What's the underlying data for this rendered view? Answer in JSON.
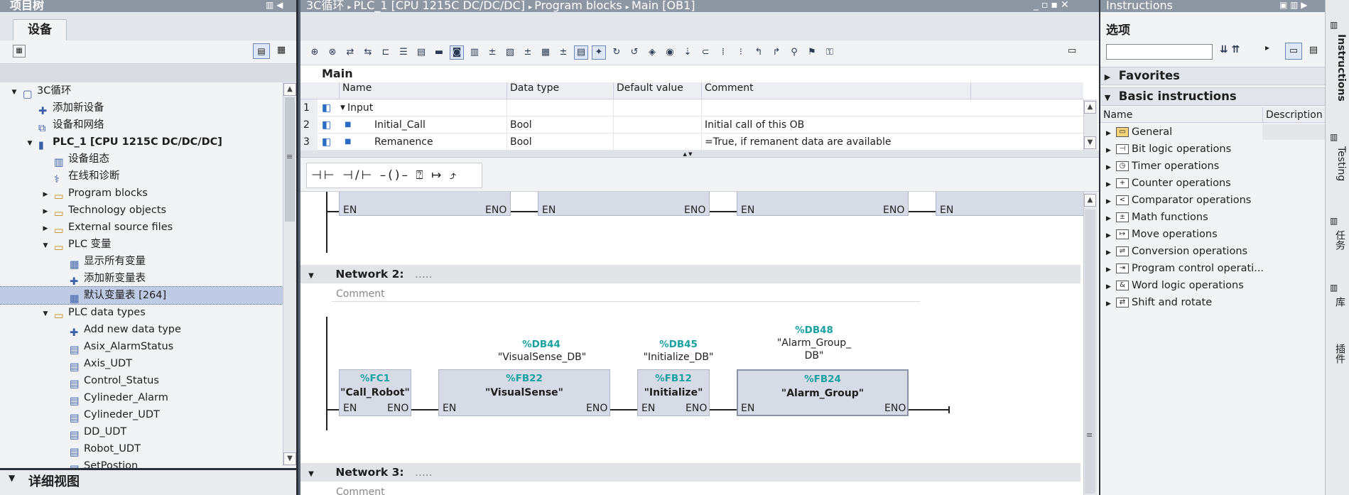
{
  "left": {
    "title": "项目树",
    "tab": "设备",
    "tree": [
      {
        "label": "3C循环",
        "level": 0,
        "twisty": "open",
        "icon": "project-icon"
      },
      {
        "label": "添加新设备",
        "level": 1,
        "twisty": "",
        "icon": "add-device-icon"
      },
      {
        "label": "设备和网络",
        "level": 1,
        "twisty": "",
        "icon": "network-icon"
      },
      {
        "label": "PLC_1 [CPU 1215C DC/DC/DC]",
        "level": 1,
        "twisty": "open",
        "icon": "plc-icon"
      },
      {
        "label": "设备组态",
        "level": 2,
        "twisty": "",
        "icon": "device-config-icon"
      },
      {
        "label": "在线和诊断",
        "level": 2,
        "twisty": "",
        "icon": "online-diagnostics-icon"
      },
      {
        "label": "Program blocks",
        "level": 2,
        "twisty": "closed",
        "icon": "folder-icon"
      },
      {
        "label": "Technology objects",
        "level": 2,
        "twisty": "closed",
        "icon": "folder-icon"
      },
      {
        "label": "External source files",
        "level": 2,
        "twisty": "closed",
        "icon": "folder-icon"
      },
      {
        "label": "PLC 变量",
        "level": 2,
        "twisty": "open",
        "icon": "folder-icon"
      },
      {
        "label": "显示所有变量",
        "level": 3,
        "twisty": "",
        "icon": "tag-table-icon"
      },
      {
        "label": "添加新变量表",
        "level": 3,
        "twisty": "",
        "icon": "add-tag-table-icon"
      },
      {
        "label": "默认变量表 [264]",
        "level": 3,
        "twisty": "",
        "icon": "tag-table-icon",
        "selected": true
      },
      {
        "label": "PLC data types",
        "level": 2,
        "twisty": "open",
        "icon": "folder-icon"
      },
      {
        "label": "Add new data type",
        "level": 3,
        "twisty": "",
        "icon": "add-data-type-icon"
      },
      {
        "label": "Asix_AlarmStatus",
        "level": 3,
        "twisty": "",
        "icon": "udt-icon"
      },
      {
        "label": "Axis_UDT",
        "level": 3,
        "twisty": "",
        "icon": "udt-icon"
      },
      {
        "label": "Control_Status",
        "level": 3,
        "twisty": "",
        "icon": "udt-icon"
      },
      {
        "label": "Cylineder_Alarm",
        "level": 3,
        "twisty": "",
        "icon": "udt-icon"
      },
      {
        "label": "Cylineder_UDT",
        "level": 3,
        "twisty": "",
        "icon": "udt-icon"
      },
      {
        "label": "DD_UDT",
        "level": 3,
        "twisty": "",
        "icon": "udt-icon"
      },
      {
        "label": "Robot_UDT",
        "level": 3,
        "twisty": "",
        "icon": "udt-icon"
      },
      {
        "label": "SetPostion",
        "level": 3,
        "twisty": "",
        "icon": "udt-icon"
      }
    ],
    "details": "详细视图"
  },
  "center": {
    "breadcrumb": [
      "3C循环",
      "PLC_1 [CPU 1215C DC/DC/DC]",
      "Program blocks",
      "Main [OB1]"
    ],
    "block_title": "Main",
    "interface_headers": [
      "Name",
      "Data type",
      "Default value",
      "Comment"
    ],
    "interface_rows": [
      {
        "num": "1",
        "name": "Input",
        "type": "",
        "default": "",
        "comment": ""
      },
      {
        "num": "2",
        "name": "Initial_Call",
        "type": "Bool",
        "default": "",
        "comment": "Initial call of this OB"
      },
      {
        "num": "3",
        "name": "Remanence",
        "type": "Bool",
        "default": "",
        "comment": "=True, if remanent data are available"
      }
    ],
    "network1": {
      "pins": [
        "EN",
        "ENO",
        "EN",
        "ENO",
        "EN",
        "ENO",
        "EN"
      ]
    },
    "network2": {
      "title": "Network 2:",
      "dots": ".....",
      "comment": "Comment",
      "blocks": [
        {
          "num": "%FC1",
          "name": "\"Call_Robot\"",
          "db_num": "",
          "db_name": ""
        },
        {
          "num": "%FB22",
          "name": "\"VisualSense\"",
          "db_num": "%DB44",
          "db_name": "\"VisualSense_DB\""
        },
        {
          "num": "%FB12",
          "name": "\"Initialize\"",
          "db_num": "%DB45",
          "db_name": "\"Initialize_DB\""
        },
        {
          "num": "%FB24",
          "name": "\"Alarm_Group\"",
          "db_num": "%DB48",
          "db_name1": "\"Alarm_Group_",
          "db_name2": "DB\""
        }
      ],
      "en": "EN",
      "eno": "ENO"
    },
    "network3": {
      "title": "Network 3:",
      "dots": ".....",
      "comment": "Comment"
    }
  },
  "right": {
    "title": "Instructions",
    "options": "选项",
    "favorites": "Favorites",
    "basic": "Basic instructions",
    "col_name": "Name",
    "col_desc": "Description",
    "items": [
      {
        "label": "General",
        "icon": "folder-icon"
      },
      {
        "label": "Bit logic operations",
        "icon": "bit-logic-icon"
      },
      {
        "label": "Timer operations",
        "icon": "timer-icon"
      },
      {
        "label": "Counter operations",
        "icon": "counter-icon"
      },
      {
        "label": "Comparator operations",
        "icon": "comparator-icon"
      },
      {
        "label": "Math functions",
        "icon": "math-icon"
      },
      {
        "label": "Move operations",
        "icon": "move-icon"
      },
      {
        "label": "Conversion operations",
        "icon": "conversion-icon"
      },
      {
        "label": "Program control operati...",
        "icon": "program-control-icon"
      },
      {
        "label": "Word logic operations",
        "icon": "word-logic-icon"
      },
      {
        "label": "Shift and rotate",
        "icon": "shift-rotate-icon"
      }
    ],
    "sidetabs": [
      "Instructions",
      "Testing",
      "任务",
      "库",
      "插件"
    ]
  },
  "colors": {
    "accent": "#1aa1a1",
    "selection": "#bfcbe4",
    "titlebar": "#8d97a4"
  }
}
